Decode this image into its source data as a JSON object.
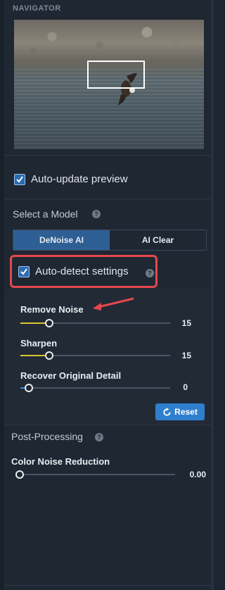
{
  "navigator": {
    "title": "NAVIGATOR"
  },
  "auto_update": {
    "label": "Auto-update preview",
    "checked": true
  },
  "model": {
    "title": "Select a Model",
    "options": [
      {
        "label": "DeNoise AI",
        "active": true
      },
      {
        "label": "AI Clear",
        "active": false
      }
    ]
  },
  "auto_detect": {
    "label": "Auto-detect settings",
    "checked": true
  },
  "sliders": [
    {
      "label": "Remove Noise",
      "value": "15",
      "fraction": 0.22
    },
    {
      "label": "Sharpen",
      "value": "15",
      "fraction": 0.22
    },
    {
      "label": "Recover Original Detail",
      "value": "0",
      "fraction": 0.0
    }
  ],
  "reset": {
    "label": "Reset"
  },
  "post_processing": {
    "title": "Post-Processing",
    "color_noise": {
      "label": "Color Noise Reduction",
      "value": "0.00",
      "fraction": 0.0
    }
  },
  "colors": {
    "accent": "#2e5f94",
    "slider_fill": "#d8c62b",
    "highlight": "#e5484d",
    "button": "#2f7fcf"
  }
}
